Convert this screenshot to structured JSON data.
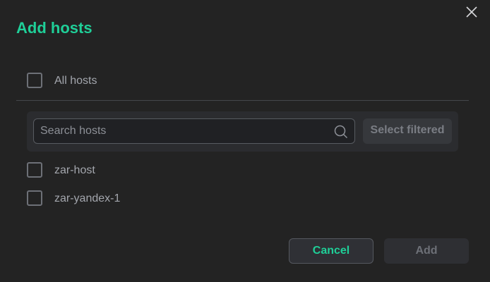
{
  "dialog": {
    "title": "Add hosts",
    "close_icon": "close-icon"
  },
  "all_hosts": {
    "label": "All hosts",
    "checked": false
  },
  "search": {
    "placeholder": "Search hosts",
    "value": "",
    "icon": "search-icon",
    "select_filtered_label": "Select filtered"
  },
  "hosts": [
    {
      "label": "zar-host",
      "checked": false
    },
    {
      "label": "zar-yandex-1",
      "checked": false
    }
  ],
  "footer": {
    "cancel_label": "Cancel",
    "add_label": "Add"
  },
  "colors": {
    "accent": "#1fcf98",
    "background": "#232323",
    "text_muted": "#a3a6ad"
  }
}
